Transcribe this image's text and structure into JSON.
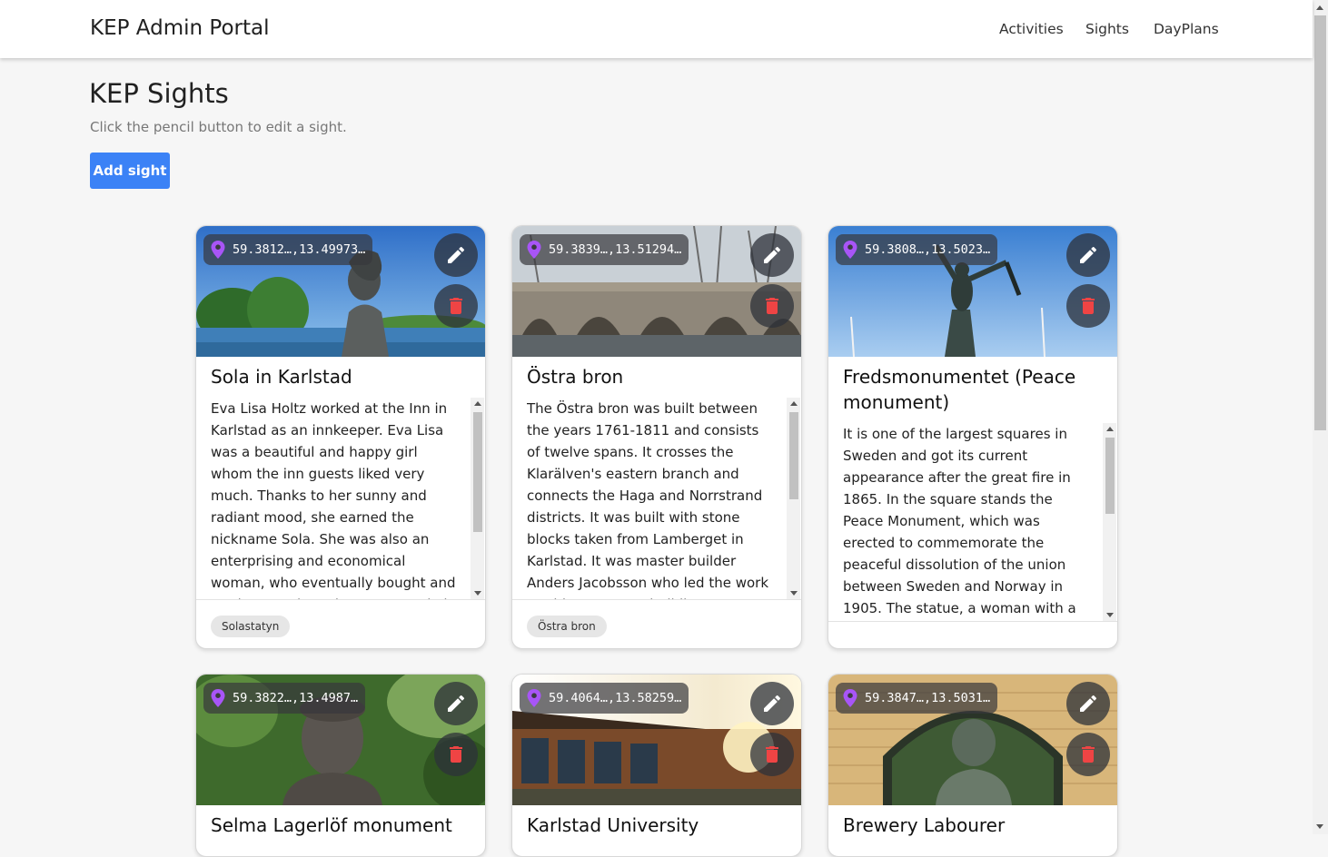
{
  "app": {
    "brand": "KEP Admin Portal"
  },
  "nav": {
    "activities": "Activities",
    "sights": "Sights",
    "dayplans": "DayPlans"
  },
  "page": {
    "title": "KEP Sights",
    "subtitle": "Click the pencil button to edit a sight.",
    "add_button": "Add sight"
  },
  "colors": {
    "accent": "#3b82f6",
    "pin": "#a855f7",
    "delete": "#ef4444"
  },
  "icons": {
    "location": "map-pin-icon",
    "edit": "pencil-icon",
    "delete": "trash-icon"
  },
  "sights": [
    {
      "coords": "59.3812…,13.49973…",
      "title": "Sola in Karlstad",
      "description": "Eva Lisa Holtz worked at the Inn in Karlstad as an innkeeper. Eva Lisa was a beautiful and happy girl whom the inn guests liked very much. Thanks to her sunny and radiant mood, she earned the nickname Sola. She was also an enterprising and economical woman, who eventually bought and ran her own inn. The statue \"Sola i",
      "tag": "Solastatyn"
    },
    {
      "coords": "59.3839…,13.51294…",
      "title": "Östra bron",
      "description": "The Östra bron was built between the years 1761-1811 and consists of twelve spans. It crosses the Klarälven's eastern branch and connects the Haga and Norrstrand districts. It was built with stone blocks taken from Lamberget in Karlstad. It was master builder Anders Jacobsson who led the work on this enormous building.",
      "tag": "Östra bron"
    },
    {
      "coords": "59.3808…,13.5023…",
      "title": "Fredsmonumentet (Peace monument)",
      "description": "It is one of the largest squares in Sweden and got its current appearance after the great fire in 1865. In the square stands the Peace Monument, which was erected to commemorate the peaceful dissolution of the union between Sweden and Norway in 1905. The statue, a woman with a broken sword,",
      "tag": ""
    },
    {
      "coords": "59.3822…,13.4987…",
      "title": "Selma Lagerlöf monument"
    },
    {
      "coords": "59.4064…,13.58259…",
      "title": "Karlstad University"
    },
    {
      "coords": "59.3847…,13.5031…",
      "title": "Brewery Labourer"
    }
  ]
}
